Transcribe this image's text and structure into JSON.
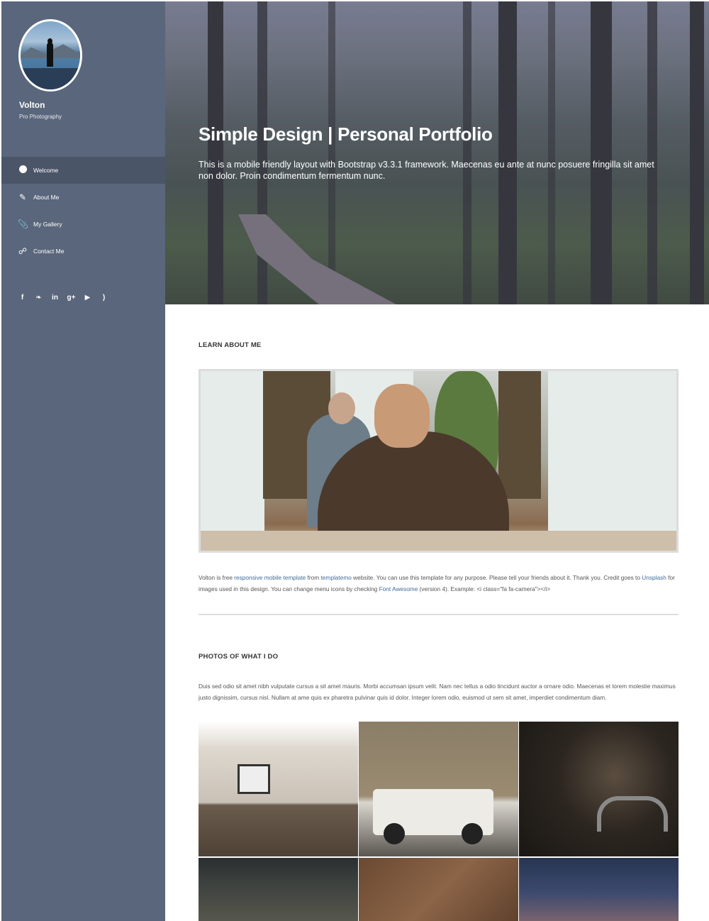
{
  "sidebar": {
    "brand_name": "Volton",
    "brand_sub": "Pro Photography",
    "nav": [
      {
        "label": "Welcome",
        "icon": "globe-icon",
        "active": true
      },
      {
        "label": "About Me",
        "icon": "pencil-icon",
        "active": false
      },
      {
        "label": "My Gallery",
        "icon": "paperclip-icon",
        "active": false
      },
      {
        "label": "Contact Me",
        "icon": "link-icon",
        "active": false
      }
    ],
    "social": [
      {
        "icon": "facebook-icon",
        "glyph": "f"
      },
      {
        "icon": "twitter-icon",
        "glyph": "❧"
      },
      {
        "icon": "linkedin-icon",
        "glyph": "in"
      },
      {
        "icon": "google-plus-icon",
        "glyph": "g+"
      },
      {
        "icon": "youtube-icon",
        "glyph": "▶"
      },
      {
        "icon": "rss-icon",
        "glyph": ")"
      }
    ]
  },
  "hero": {
    "title": "Simple Design | Personal Portfolio",
    "text": "This is a mobile friendly layout with Bootstrap v3.3.1 framework. Maecenas eu ante at nunc posuere fringilla sit amet non dolor. Proin condimentum fermentum nunc."
  },
  "about": {
    "heading": "LEARN ABOUT ME",
    "text_1": "Volton is free ",
    "link_1": "responsive mobile template",
    "text_2": " from ",
    "link_2": "templatemo",
    "text_3": " website. You can use this template for any purpose. Please tell your friends about it. Thank you. Credit goes to ",
    "link_3": "Unsplash",
    "text_4": " for images used in this design. You can change menu icons by checking ",
    "link_4": "Font Awesome",
    "text_5": " (version 4). Example: <i class=\"fa fa-camera\"></i>"
  },
  "photos": {
    "heading": "PHOTOS OF WHAT I DO",
    "text": "Duis sed odio sit amet nibh vulputate cursus a sit amet mauris. Morbi accumsan ipsum velit. Nam nec tellus a odio tincidunt auctor a ornare odio. Maecenas et lorem molestie maximus justo dignissim, cursus nisl. Nullam at ame quis ex pharetra pulvinar quis id dolor. Integer lorem odio, euismod ut sem sit amet, imperdiet condimentum diam."
  },
  "colors": {
    "sidebar": "#5a667b",
    "sidebar_active": "#4a5568",
    "link": "#3f6c9b"
  }
}
